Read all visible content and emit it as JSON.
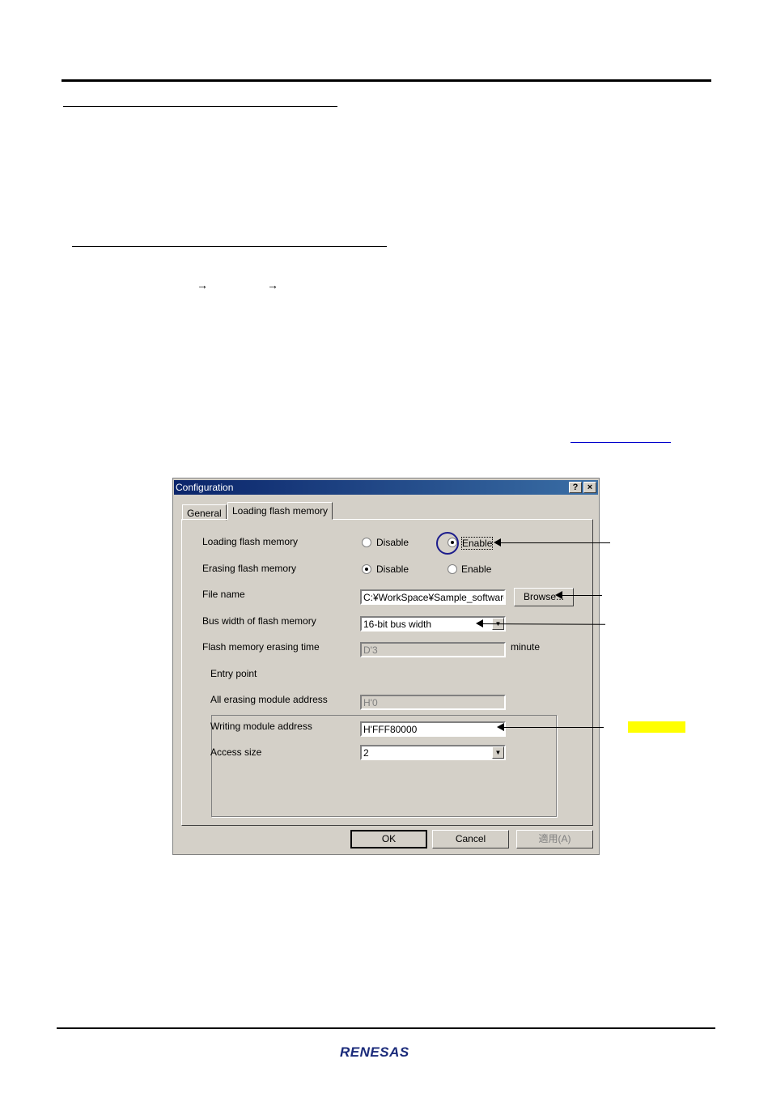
{
  "breadcrumb": {
    "arrow1": "→",
    "arrow2": "→"
  },
  "dialog": {
    "title": "Configuration",
    "help_btn": "?",
    "close_btn": "×",
    "tabs": [
      "General",
      "Loading flash memory"
    ],
    "rows": {
      "loading_label": "Loading flash memory",
      "erasing_label": "Erasing flash memory",
      "file_label": "File name",
      "bus_label": "Bus width of flash memory",
      "erase_time_label": "Flash memory erasing time"
    },
    "radio": {
      "disable": "Disable",
      "enable": "Enable"
    },
    "loading_selected": "Enable",
    "erasing_selected": "Disable",
    "file_value": "C:¥WorkSpace¥Sample_software",
    "browse_label": "Browse...",
    "bus_value": "16-bit bus width",
    "erase_time_value": "D'3",
    "erase_time_unit": "minute",
    "entry": {
      "group_label": "Entry point",
      "all_erasing_label": "All erasing module address",
      "all_erasing_value": "H'0",
      "writing_label": "Writing module address",
      "writing_value": "H'FFF80000",
      "access_label": "Access size",
      "access_value": "2"
    },
    "ok_label": "OK",
    "cancel_label": "Cancel",
    "apply_label": "適用(A)"
  },
  "footer": {
    "logo": "RENESAS"
  },
  "colors": {
    "highlight": "#ffff00",
    "title_bar": "#0a246a",
    "circle": "#1c1c8c"
  }
}
